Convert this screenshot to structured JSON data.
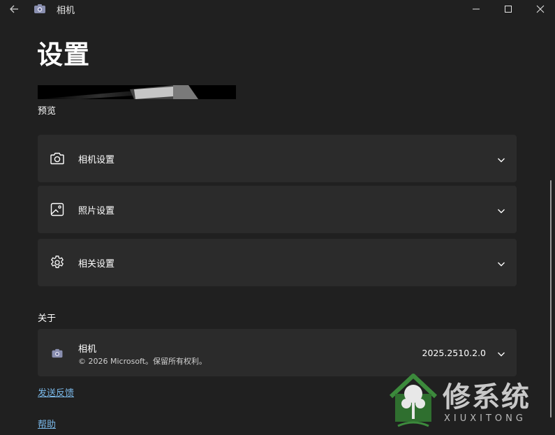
{
  "window": {
    "title": "相机"
  },
  "page": {
    "title": "设置",
    "preview_label": "预览"
  },
  "sections": [
    {
      "label": "相机设置",
      "icon": "camera-icon"
    },
    {
      "label": "照片设置",
      "icon": "photo-icon"
    },
    {
      "label": "相关设置",
      "icon": "gear-icon"
    }
  ],
  "about": {
    "heading": "关于",
    "app_name": "相机",
    "copyright": "© 2026 Microsoft。保留所有权利。",
    "version": "2025.2510.2.0"
  },
  "links": {
    "feedback": "发送反馈",
    "help": "帮助"
  },
  "watermark": {
    "text": "修系统",
    "sub": "XIUXITONG"
  }
}
